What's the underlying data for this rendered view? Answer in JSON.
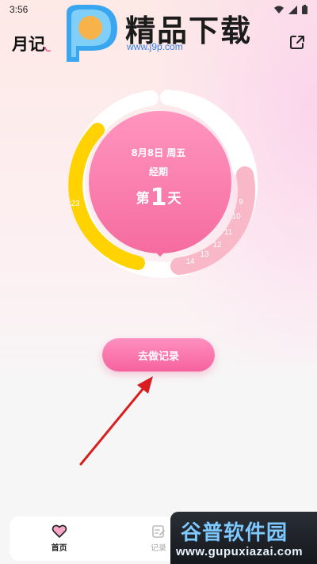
{
  "status_bar": {
    "time": "3:56"
  },
  "header": {
    "app_title": "月记"
  },
  "watermark": {
    "brand": "精品下载",
    "url": "www.j9p.com"
  },
  "cycle": {
    "date": "8月8日 周五",
    "phase": "经期",
    "day_prefix": "第",
    "day_number": "1",
    "day_suffix": "天",
    "labels": [
      "23",
      "9",
      "10",
      "11",
      "12",
      "13",
      "14"
    ]
  },
  "actions": {
    "record_label": "去做记录"
  },
  "bottom_nav": {
    "items": [
      {
        "label": "首页",
        "icon": "heart-icon",
        "active": true
      },
      {
        "label": "记录",
        "icon": "edit-note-icon",
        "active": false
      }
    ]
  },
  "watermark_bottom": {
    "title": "谷普软件园",
    "url": "www.gupuxiazai.com"
  },
  "colors": {
    "period_pink": "#f77aa9",
    "ring_yellow": "#ffd200",
    "ring_light_pink": "#f9b8c8",
    "button_pink": "#f6629e",
    "arrow_red": "#d81e1e"
  }
}
